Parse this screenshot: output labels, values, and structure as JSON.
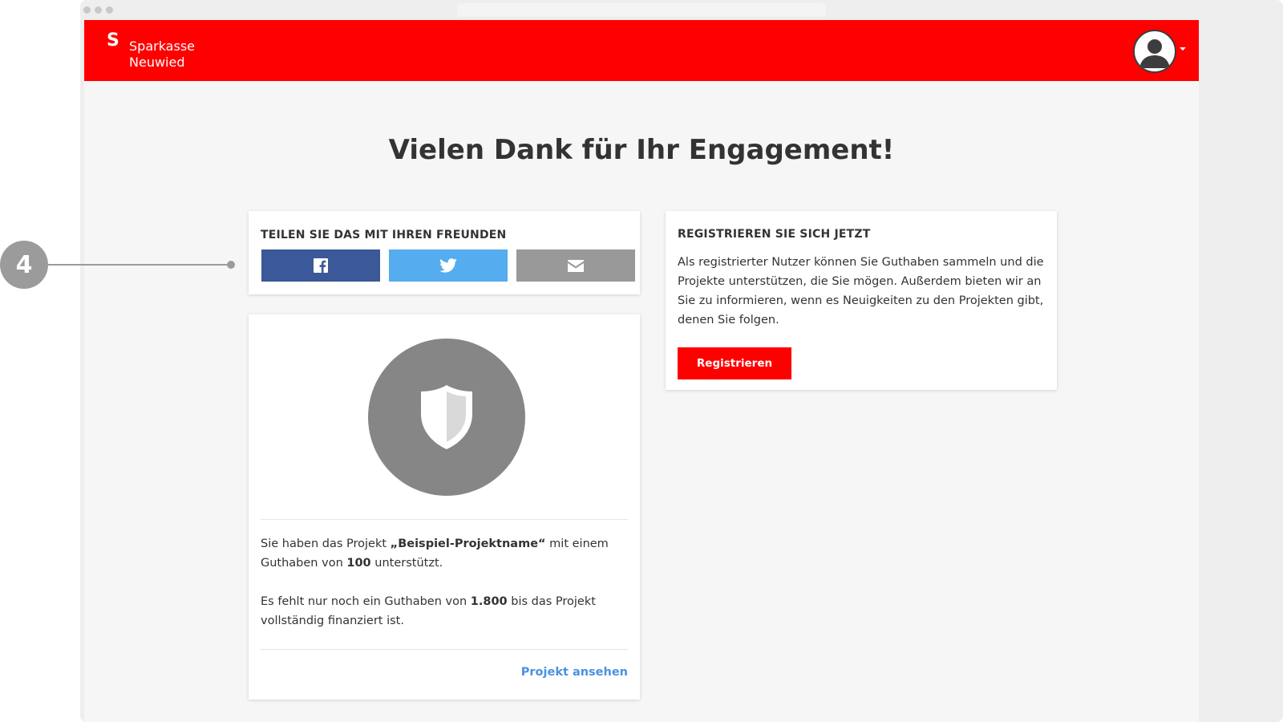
{
  "header": {
    "logo_mark": "S",
    "logo_line1": "Sparkasse",
    "logo_line2": "Neuwied"
  },
  "page_title": "Vielen Dank für Ihr Engagement!",
  "share_card": {
    "heading": "TEILEN SIE DAS MIT IHREN FREUNDEN",
    "buttons": [
      {
        "icon": "facebook-icon",
        "color": "#3b5998"
      },
      {
        "icon": "twitter-icon",
        "color": "#55acee"
      },
      {
        "icon": "mail-icon",
        "color": "#999999"
      }
    ]
  },
  "register_card": {
    "heading": "REGISTRIEREN SIE SICH JETZT",
    "text": "Als registrierter Nutzer können Sie Guthaben sammeln und die Projekte unterstützen, die Sie mögen. Außerdem bieten wir an Sie zu informieren, wenn es Neuigkeiten zu den Projekten gibt, denen Sie folgen.",
    "button_label": "Registrieren"
  },
  "project_card": {
    "badge_icon": "shield-icon",
    "p1_before": "Sie haben das Projekt ",
    "p1_project": "„Beispiel-Projektname“",
    "p1_middle": " mit einem Guthaben von ",
    "p1_amount": "100",
    "p1_after": " unterstützt.",
    "p2_before": "Es fehlt nur noch ein Guthaben von ",
    "p2_amount": "1.800",
    "p2_after": " bis das Projekt vollständig finanziert ist.",
    "link_label": "Projekt ansehen"
  },
  "callout": {
    "number": "4"
  },
  "colors": {
    "brand_red": "#ff0000",
    "link_blue": "#4a90e2",
    "badge_gray": "#868686"
  }
}
